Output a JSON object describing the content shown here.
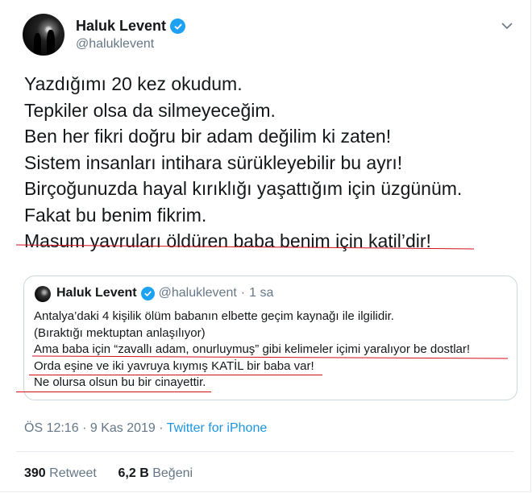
{
  "author": {
    "name": "Haluk Levent",
    "handle": "@haluklevent",
    "avatar_icon": "avatar-photo",
    "verified_icon": "verified-badge-icon"
  },
  "tweet": {
    "lines": [
      "Yazdığımı 20 kez okudum.",
      "Tepkiler olsa da silmeyeceğim.",
      "Ben her fikri doğru bir adam değilim ki zaten!",
      "Sistem insanları intihara sürükleyebilir bu ayrı!",
      "Birçoğunuzda hayal kırıklığı yaşattığım için üzgünüm.",
      "Fakat bu benim fikrim.",
      "Masum yavruları öldüren baba benim için katil’dir!"
    ]
  },
  "quoted": {
    "name": "Haluk Levent",
    "handle": "@haluklevent",
    "dot": "·",
    "time": "1 sa",
    "lines": [
      "Antalya’daki 4 kişilik ölüm babanın elbette geçim kaynağı ile ilgilidir.",
      "(Bıraktığı mektuptan anlaşılıyor)",
      "Ama baba için “zavallı adam, onurluymuş” gibi kelimeler içimi yaralıyor be dostlar!",
      "Orda eşine ve iki yavruya kıymış KATİL bir baba var!",
      "Ne olursa olsun bu bir cinayettir."
    ]
  },
  "meta": {
    "time": "ÖS 12:16",
    "dot": "·",
    "date": "9 Kas 2019",
    "source": "Twitter for iPhone"
  },
  "stats": {
    "retweets_count": "390",
    "retweets_label": "Retweet",
    "likes_count": "6,2 B",
    "likes_label": "Beğeni"
  },
  "colors": {
    "accent": "#1da1f2",
    "link": "#1b95e0",
    "annotation_red": "#d40f1a",
    "muted": "#657786"
  }
}
